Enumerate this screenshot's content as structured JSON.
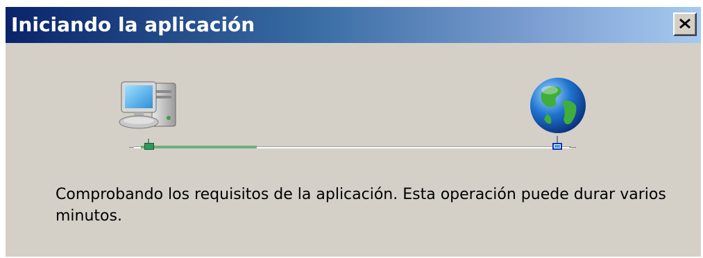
{
  "window": {
    "title": "Iniciando la aplicación",
    "close_label": "Cerrar"
  },
  "icons": {
    "left": "computer-icon",
    "right": "globe-icon",
    "close": "close-icon"
  },
  "progress": {
    "fraction": 0.28
  },
  "status": {
    "message": "Comprobando los requisitos de la aplicación. Esta operación puede durar varios minutos."
  },
  "colors": {
    "title_start": "#0a246a",
    "title_end": "#a6caf0",
    "dialog_bg": "#d4d0c8",
    "progress": "#6fb07a"
  }
}
